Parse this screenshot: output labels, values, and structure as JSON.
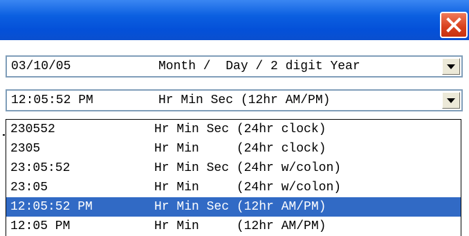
{
  "window": {
    "close_icon": "close-x-icon"
  },
  "date_combo": {
    "value": "03/10/05",
    "format": "Month /  Day / 2 digit Year"
  },
  "time_combo": {
    "value": "12:05:52 PM",
    "format": "Hr Min Sec (12hr AM/PM)"
  },
  "time_options": [
    {
      "value": "230552",
      "format": "Hr Min Sec (24hr clock)"
    },
    {
      "value": "2305",
      "format": "Hr Min     (24hr clock)"
    },
    {
      "value": "23:05:52",
      "format": "Hr Min Sec (24hr w/colon)"
    },
    {
      "value": "23:05",
      "format": "Hr Min     (24hr w/colon)"
    },
    {
      "value": "12:05:52 PM",
      "format": "Hr Min Sec (12hr AM/PM)"
    },
    {
      "value": "12:05 PM",
      "format": "Hr Min     (12hr AM/PM)"
    }
  ],
  "selected_option_index": 4,
  "colors": {
    "titlebar": "#0450d8",
    "selection": "#316ac5",
    "close_button": "#d8401c"
  }
}
